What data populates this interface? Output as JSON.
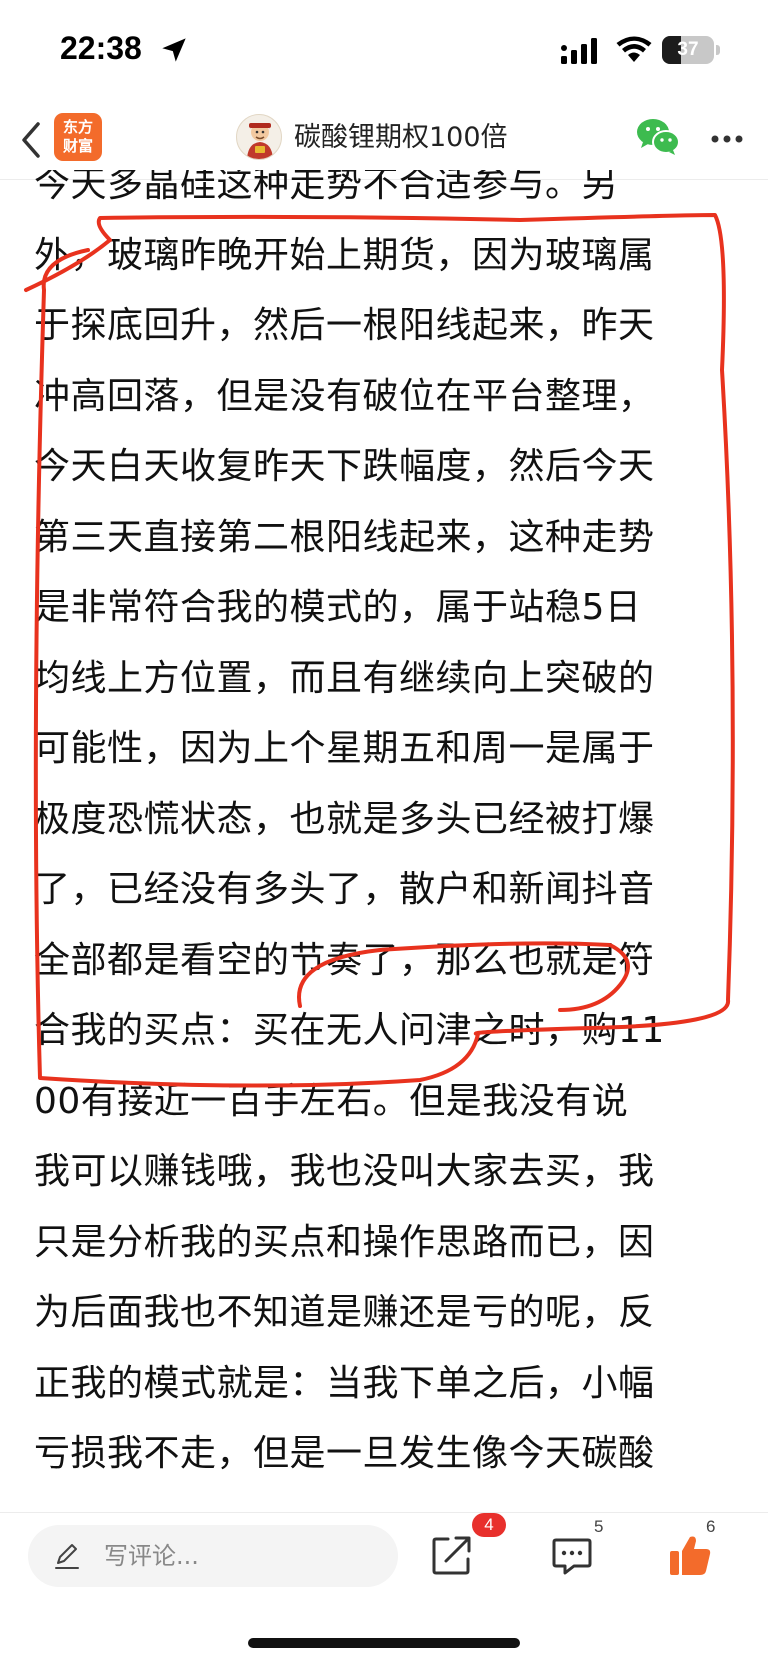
{
  "status_bar": {
    "time": "22:38",
    "battery_level": "37",
    "battery_fraction": 0.37
  },
  "nav": {
    "logo_line1": "东方",
    "logo_line2": "财富",
    "title": "碳酸锂期权100倍",
    "icons": [
      "back-icon",
      "wechat-icon",
      "more-icon"
    ]
  },
  "article": {
    "lines": [
      "今天多晶硅这种走势不合适参与。另",
      "外，玻璃昨晚开始上期货，因为玻璃属",
      "于探底回升，然后一根阳线起来，昨天",
      "冲高回落，但是没有破位在平台整理，",
      "今天白天收复昨天下跌幅度，然后今天",
      "第三天直接第二根阳线起来，这种走势",
      "是非常符合我的模式的，属于站稳5日",
      "均线上方位置，而且有继续向上突破的",
      "可能性，因为上个星期五和周一是属于",
      "极度恐慌状态，也就是多头已经被打爆",
      "了，已经没有多头了，散户和新闻抖音",
      "全部都是看空的节奏了，那么也就是符",
      "合我的买点：买在无人问津之时，购11",
      "00有接近一百手左右。但是我没有说",
      "我可以赚钱哦，我也没叫大家去买，我",
      "只是分析我的买点和操作思路而已，因",
      "为后面我也不知道是赚还是亏的呢，反",
      "正我的模式就是：当我下单之后，小幅",
      "亏损我不走，但是一旦发生像今天碳酸"
    ],
    "annotation_color": "#e8321e"
  },
  "bottom_bar": {
    "comment_placeholder": "写评论...",
    "share_badge": "4",
    "comment_count": "5",
    "like_count": "6",
    "like_color": "#f36b2b",
    "badge_color": "#e8302c"
  }
}
